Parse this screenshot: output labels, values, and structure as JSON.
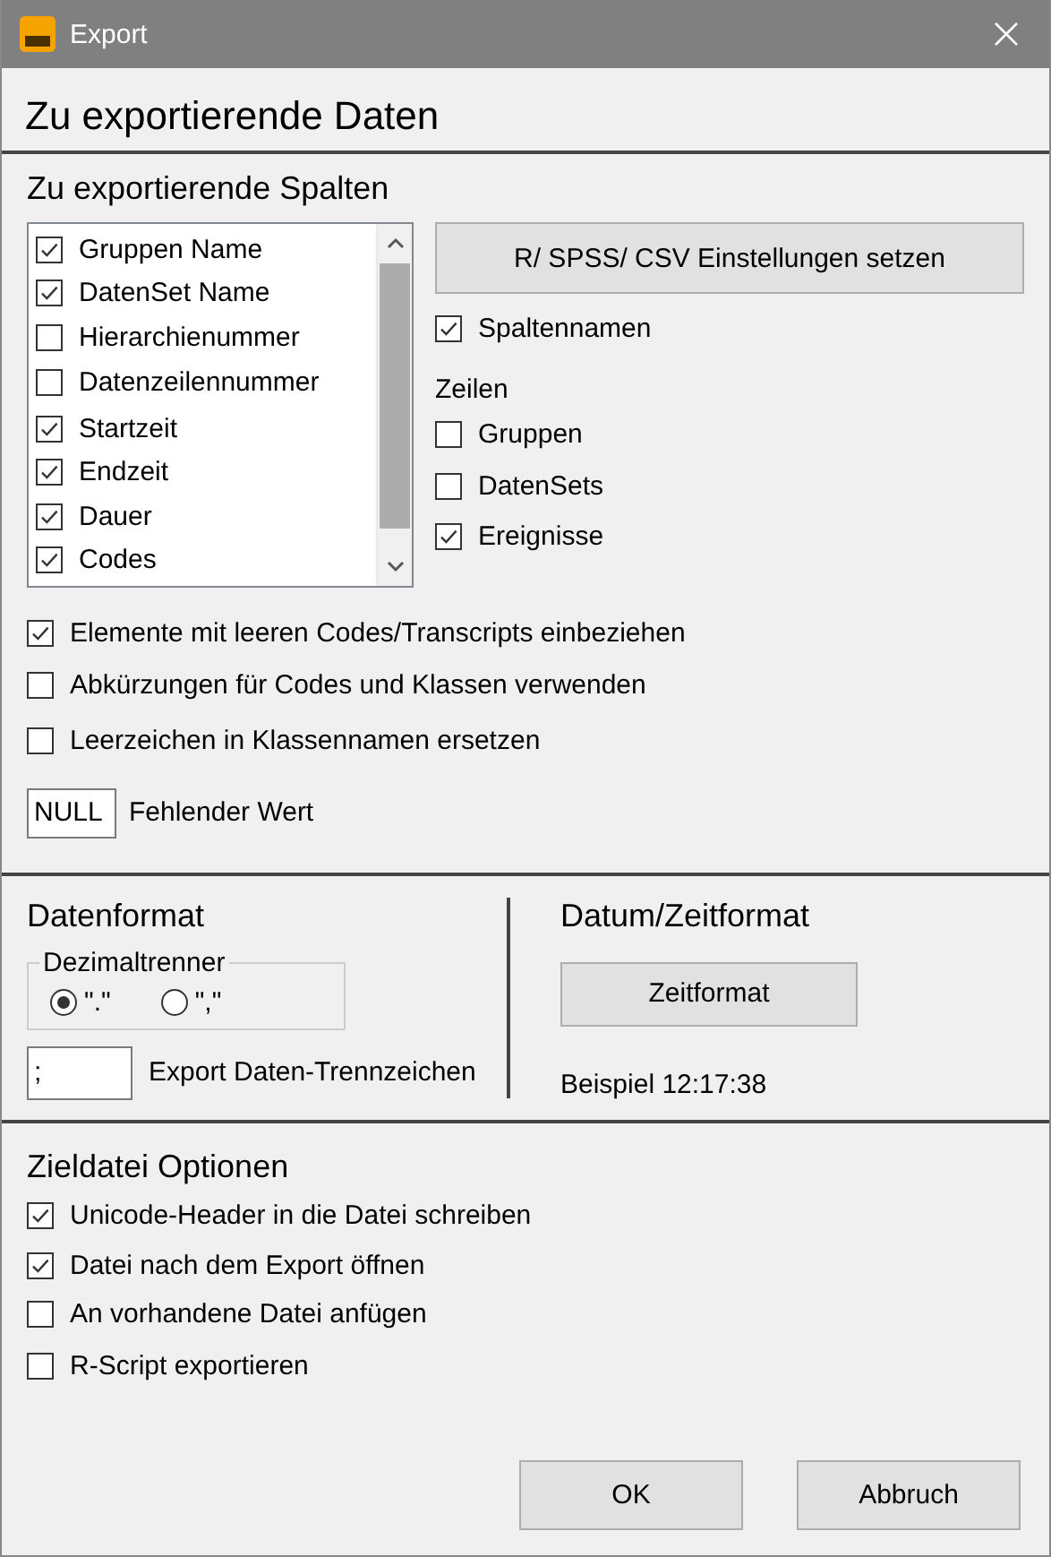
{
  "window": {
    "title": "Export"
  },
  "heading": "Zu exportierende Daten",
  "columns_section": {
    "title": "Zu exportierende Spalten",
    "columns": [
      {
        "label": "Gruppen Name",
        "checked": true
      },
      {
        "label": "DatenSet Name",
        "checked": true
      },
      {
        "label": "Hierarchienummer",
        "checked": false
      },
      {
        "label": "Datenzeilennummer",
        "checked": false
      },
      {
        "label": "Startzeit",
        "checked": true
      },
      {
        "label": "Endzeit",
        "checked": true
      },
      {
        "label": "Dauer",
        "checked": true
      },
      {
        "label": "Codes",
        "checked": true
      }
    ],
    "settings_button": "R/ SPSS/ CSV Einstellungen setzen",
    "column_names": {
      "label": "Spaltennamen",
      "checked": true
    },
    "rows_label": "Zeilen",
    "rows": [
      {
        "label": "Gruppen",
        "checked": false
      },
      {
        "label": "DatenSets",
        "checked": false
      },
      {
        "label": "Ereignisse",
        "checked": true
      }
    ]
  },
  "options": [
    {
      "label": "Elemente mit leeren Codes/Transcripts einbeziehen",
      "checked": true
    },
    {
      "label": "Abkürzungen für Codes und Klassen verwenden",
      "checked": false
    },
    {
      "label": "Leerzeichen in Klassennamen ersetzen",
      "checked": false
    }
  ],
  "missing_value": {
    "value": "NULL",
    "label": "Fehlender Wert"
  },
  "data_format": {
    "title": "Datenformat",
    "decimal_group": "Dezimaltrenner",
    "decimal_options": [
      {
        "label": "\".\"",
        "selected": true
      },
      {
        "label": "\",\"",
        "selected": false
      }
    ],
    "delimiter": {
      "value": ";",
      "label": "Export Daten-Trennzeichen"
    }
  },
  "date_format": {
    "title": "Datum/Zeitformat",
    "button": "Zeitformat",
    "example": "Beispiel 12:17:38"
  },
  "target": {
    "title": "Zieldatei Optionen",
    "options": [
      {
        "label": "Unicode-Header in die Datei schreiben",
        "checked": true
      },
      {
        "label": "Datei nach dem Export öffnen",
        "checked": true
      },
      {
        "label": "An vorhandene Datei anfügen",
        "checked": false
      },
      {
        "label": "R-Script exportieren",
        "checked": false
      }
    ]
  },
  "buttons": [
    {
      "label": "OK"
    },
    {
      "label": "Abbruch"
    }
  ]
}
